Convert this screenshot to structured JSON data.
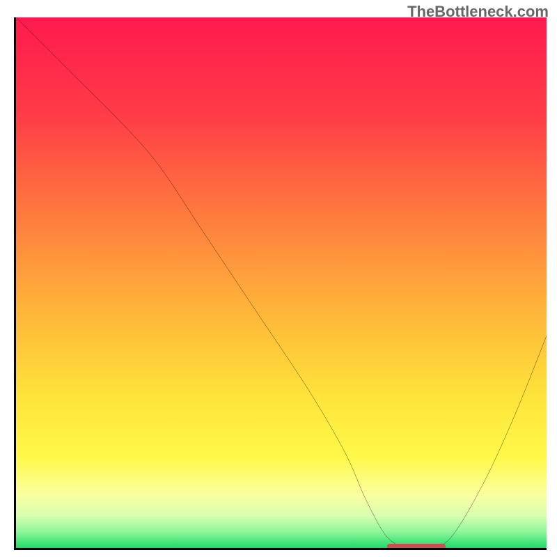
{
  "watermark": "TheBottleneck.com",
  "chart_data": {
    "type": "line",
    "title": "",
    "xlabel": "",
    "ylabel": "",
    "xlim": [
      0,
      100
    ],
    "ylim": [
      0,
      100
    ],
    "series": [
      {
        "name": "bottleneck-curve",
        "x": [
          0,
          10,
          20,
          27,
          35,
          45,
          55,
          62,
          66,
          70,
          74,
          78,
          82,
          88,
          94,
          100
        ],
        "y": [
          100,
          90,
          80,
          72,
          60,
          45,
          30,
          18,
          9,
          2,
          0,
          0,
          2,
          12,
          25,
          40
        ]
      }
    ],
    "optimal_range": {
      "x_start": 70,
      "x_end": 81,
      "y": 0
    },
    "gradient_stops": [
      {
        "offset": 0,
        "color": "#ff1a4e"
      },
      {
        "offset": 18,
        "color": "#ff3b47"
      },
      {
        "offset": 38,
        "color": "#ff7d3e"
      },
      {
        "offset": 55,
        "color": "#ffb43a"
      },
      {
        "offset": 72,
        "color": "#ffe53b"
      },
      {
        "offset": 83,
        "color": "#fff94a"
      },
      {
        "offset": 90,
        "color": "#faffa0"
      },
      {
        "offset": 94,
        "color": "#d8ffb0"
      },
      {
        "offset": 97,
        "color": "#8ef598"
      },
      {
        "offset": 100,
        "color": "#1edb6a"
      }
    ]
  }
}
